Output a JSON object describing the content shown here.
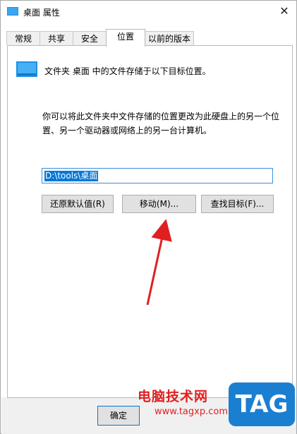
{
  "window": {
    "title": "桌面 属性",
    "close_glyph": "✕"
  },
  "tabs": [
    {
      "label": "常规",
      "active": false
    },
    {
      "label": "共享",
      "active": false
    },
    {
      "label": "安全",
      "active": false
    },
    {
      "label": "位置",
      "active": true
    },
    {
      "label": "以前的版本",
      "active": false
    }
  ],
  "location": {
    "description": "文件夹 桌面 中的文件存储于以下目标位置。",
    "info": "你可以将此文件夹中文件存储的位置更改为此硬盘上的另一个位置、另一个驱动器或网络上的另一台计算机。",
    "path": "D:\\tools\\桌面"
  },
  "buttons": {
    "restore_default": "还原默认值(R)",
    "move": "移动(M)...",
    "find_target": "查找目标(F)...",
    "ok": "确定"
  },
  "watermark": {
    "site_name": "电脑技术网",
    "url": "www.tagxp.com",
    "logo_text": "TAG"
  },
  "colors": {
    "accent": "#0078d7",
    "arrow": "#e02020",
    "folder": "#1e90e6"
  }
}
